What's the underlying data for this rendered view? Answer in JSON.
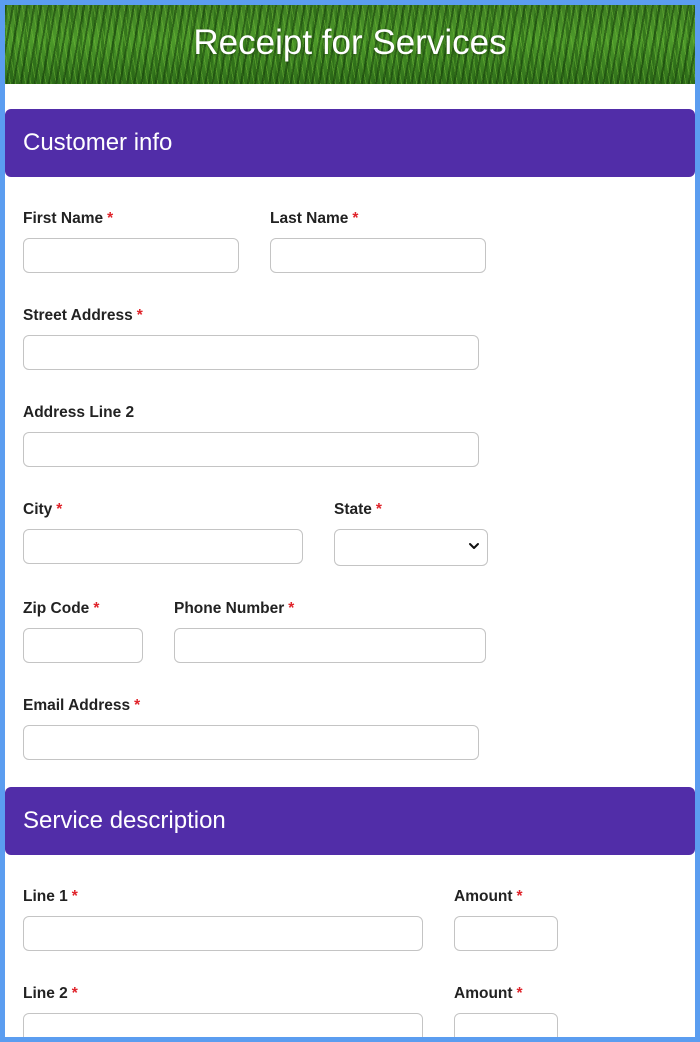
{
  "header": {
    "title": "Receipt for Services"
  },
  "sections": {
    "customer": {
      "title": "Customer info"
    },
    "service": {
      "title": "Service description"
    }
  },
  "required_marker": "*",
  "fields": {
    "first_name": {
      "label": "First Name",
      "value": ""
    },
    "last_name": {
      "label": "Last Name",
      "value": ""
    },
    "street_address": {
      "label": "Street Address",
      "value": ""
    },
    "address_line_2": {
      "label": "Address Line 2",
      "value": ""
    },
    "city": {
      "label": "City",
      "value": ""
    },
    "state": {
      "label": "State",
      "selected": ""
    },
    "zip_code": {
      "label": "Zip Code",
      "value": ""
    },
    "phone_number": {
      "label": "Phone Number",
      "value": ""
    },
    "email_address": {
      "label": "Email Address",
      "value": ""
    },
    "line_1": {
      "label": "Line 1",
      "value": ""
    },
    "amount_1": {
      "label": "Amount",
      "value": ""
    },
    "line_2": {
      "label": "Line 2",
      "value": ""
    },
    "amount_2": {
      "label": "Amount",
      "value": ""
    }
  },
  "colors": {
    "page_border": "#5b9df0",
    "section_header": "#512da8",
    "required": "#e0242b",
    "label_text": "#222222"
  }
}
